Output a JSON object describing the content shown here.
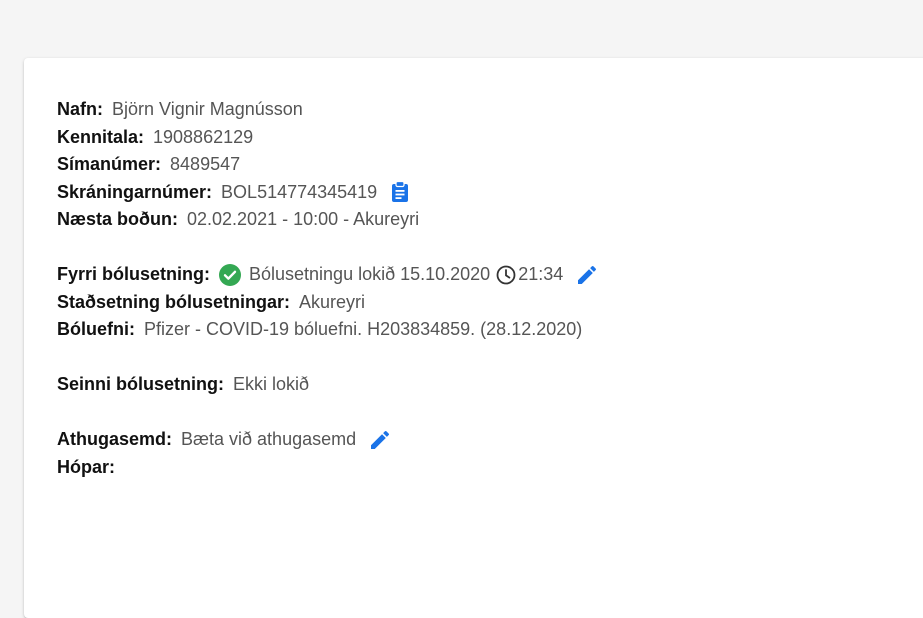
{
  "patient": {
    "name_label": "Nafn:",
    "name": "Björn Vignir Magnússon",
    "kennitala_label": "Kennitala:",
    "kennitala": "1908862129",
    "phone_label": "Símanúmer:",
    "phone": "8489547",
    "registration_label": "Skráningarnúmer:",
    "registration": "BOL514774345419",
    "next_label": "Næsta boðun:",
    "next": "02.02.2021 - 10:00 - Akureyri"
  },
  "first_dose": {
    "label": "Fyrri bólusetning:",
    "status": "Bólusetningu lokið 15.10.2020",
    "time": "21:34",
    "location_label": "Staðsetning bólusetningar:",
    "location": "Akureyri",
    "vaccine_label": "Bóluefni:",
    "vaccine": "Pfizer - COVID-19 bóluefni. H203834859. (28.12.2020)"
  },
  "second_dose": {
    "label": "Seinni bólusetning:",
    "status": "Ekki lokið"
  },
  "notes": {
    "label": "Athugasemd:",
    "value": "Bæta við athugasemd",
    "groups_label": "Hópar:"
  },
  "colors": {
    "accent": "#1a73e8",
    "success": "#34a853"
  },
  "icons": {
    "clipboard": "clipboard-icon",
    "check": "check-circle-icon",
    "clock": "clock-icon",
    "pencil": "pencil-icon"
  }
}
